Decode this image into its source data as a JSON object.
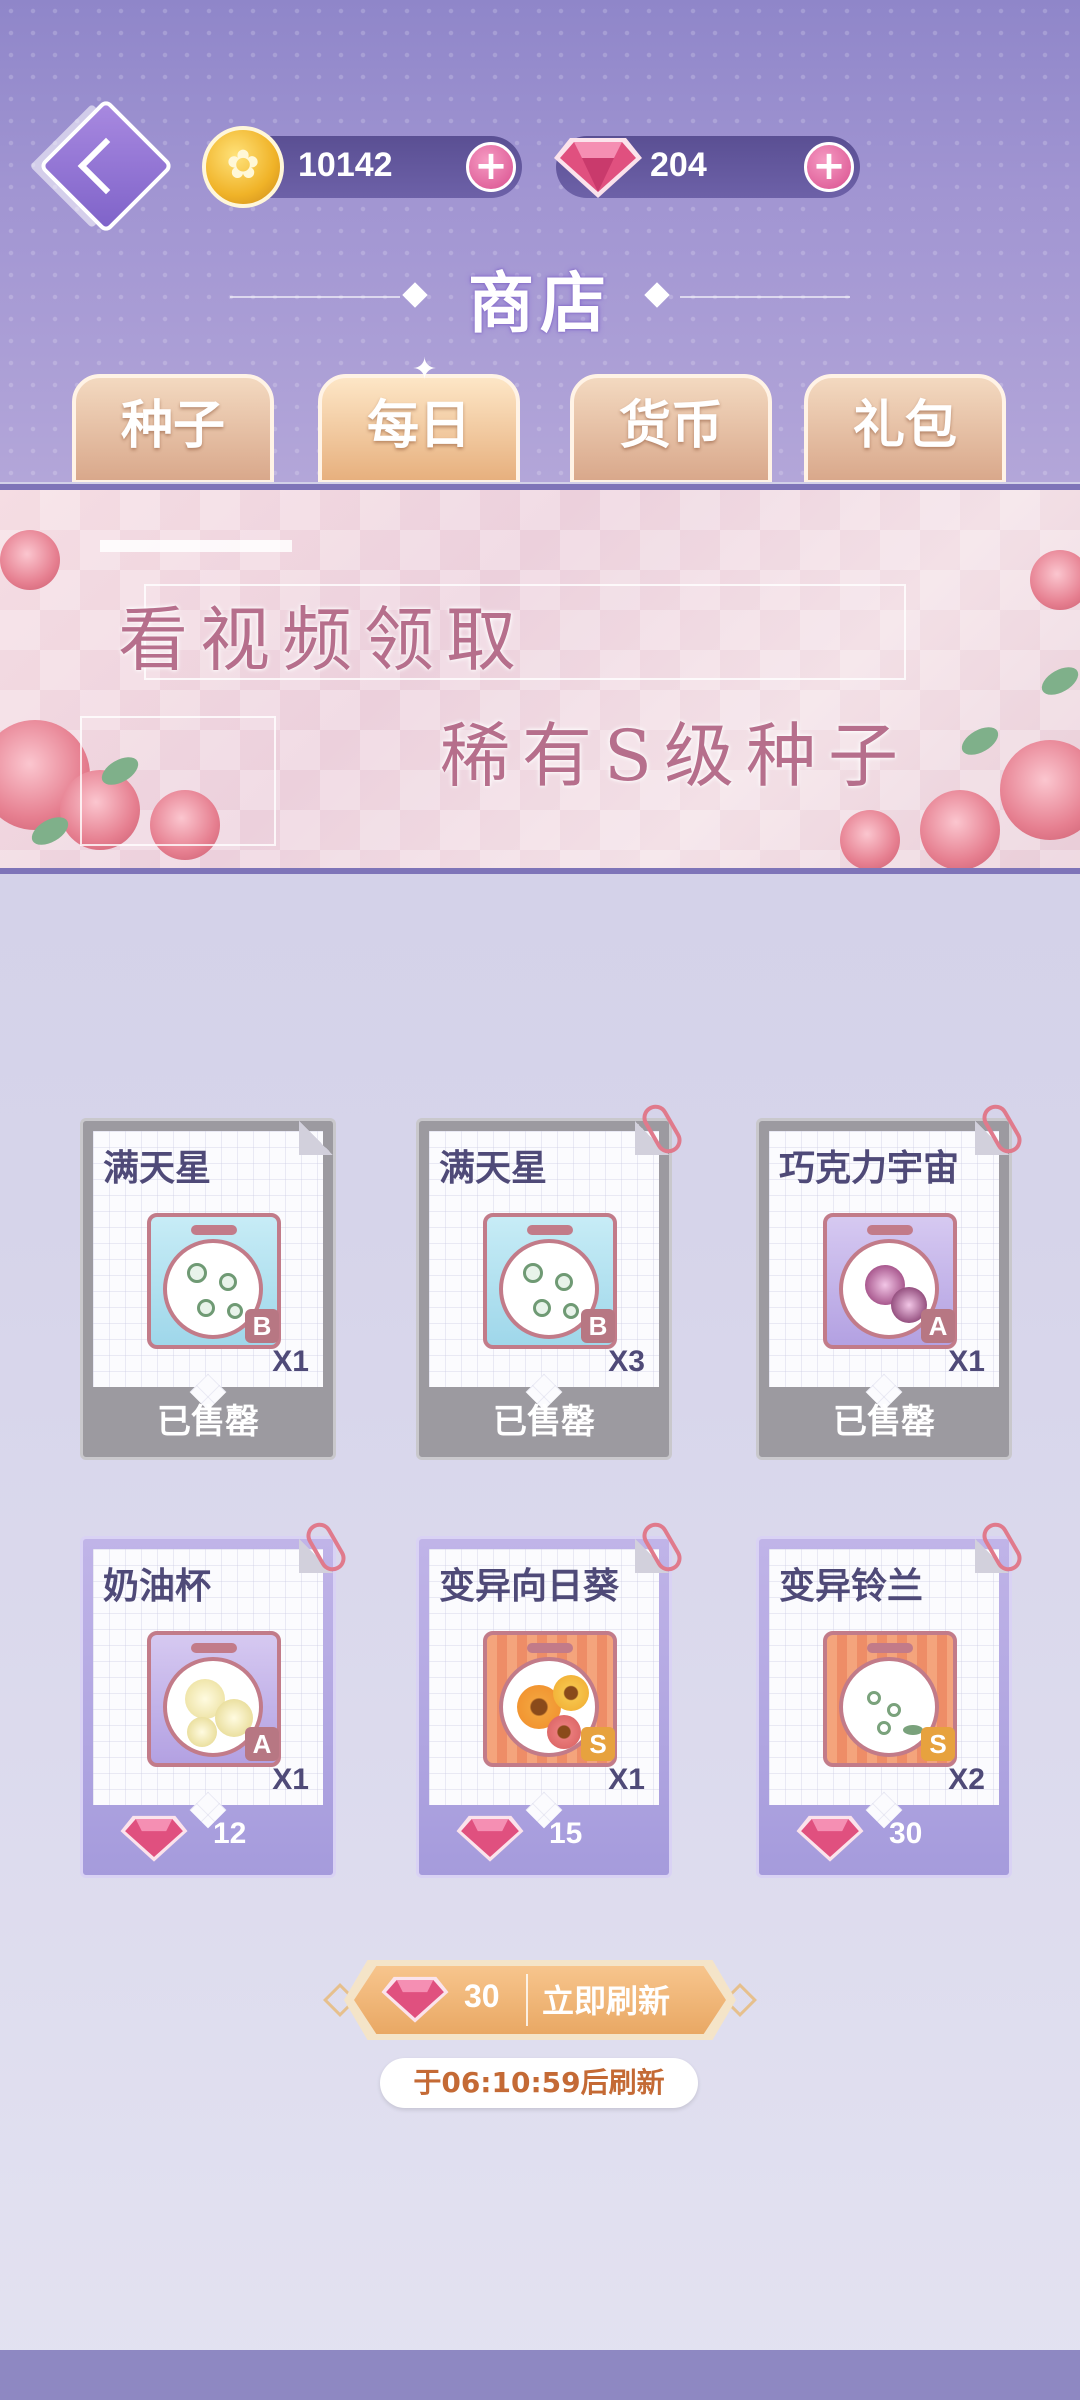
{
  "header": {
    "coins": "10142",
    "gems": "204",
    "title": "商店",
    "tabs": [
      {
        "label": "种子",
        "active": false
      },
      {
        "label": "每日",
        "active": true
      },
      {
        "label": "货币",
        "active": false
      },
      {
        "label": "礼包",
        "active": false
      }
    ]
  },
  "banner": {
    "line1": "看视频领取",
    "line2": "稀有S级种子"
  },
  "items": [
    {
      "name": "满天星",
      "grade": "B",
      "qty": "X1",
      "status": "已售罄",
      "bag": "blue"
    },
    {
      "name": "满天星",
      "grade": "B",
      "qty": "X3",
      "status": "已售罄",
      "bag": "blue"
    },
    {
      "name": "巧克力宇宙",
      "grade": "A",
      "qty": "X1",
      "status": "已售罄",
      "bag": "purple"
    },
    {
      "name": "奶油杯",
      "grade": "A",
      "qty": "X1",
      "price": "12",
      "bag": "purple"
    },
    {
      "name": "变异向日葵",
      "grade": "S",
      "qty": "X1",
      "price": "15",
      "bag": "orange"
    },
    {
      "name": "变异铃兰",
      "grade": "S",
      "qty": "X2",
      "price": "30",
      "bag": "orange"
    }
  ],
  "refresh": {
    "cost": "30",
    "label": "立即刷新",
    "timer": "于06:10:59后刷新"
  },
  "colors": {
    "header_top": "#8f86c9",
    "gem": "#e0507f",
    "coin": "#f0b328",
    "sold_card": "#9c9aa0",
    "avail_card": "#a59bdc"
  }
}
